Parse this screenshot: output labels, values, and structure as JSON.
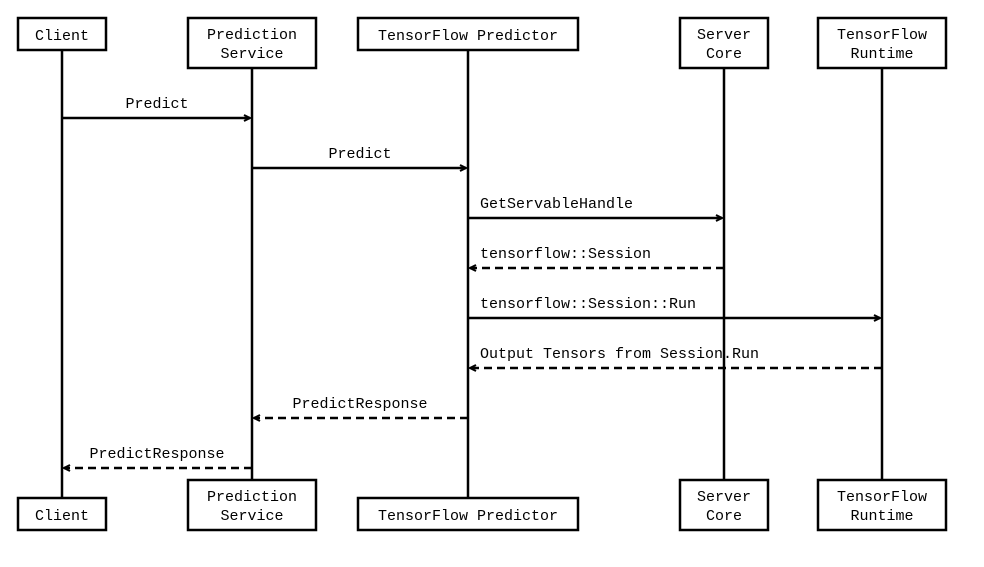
{
  "diagram": {
    "type": "sequence",
    "participants": [
      {
        "id": "client",
        "label_lines": [
          "Client"
        ]
      },
      {
        "id": "prediction_service",
        "label_lines": [
          "Prediction",
          "Service"
        ]
      },
      {
        "id": "tf_predictor",
        "label_lines": [
          "TensorFlow Predictor"
        ]
      },
      {
        "id": "server_core",
        "label_lines": [
          "Server",
          "Core"
        ]
      },
      {
        "id": "tf_runtime",
        "label_lines": [
          "TensorFlow",
          "Runtime"
        ]
      }
    ],
    "messages": [
      {
        "from": "client",
        "to": "prediction_service",
        "text": "Predict",
        "style": "solid"
      },
      {
        "from": "prediction_service",
        "to": "tf_predictor",
        "text": "Predict",
        "style": "solid"
      },
      {
        "from": "tf_predictor",
        "to": "server_core",
        "text": "GetServableHandle",
        "style": "solid"
      },
      {
        "from": "server_core",
        "to": "tf_predictor",
        "text": "tensorflow::Session",
        "style": "dashed"
      },
      {
        "from": "tf_predictor",
        "to": "tf_runtime",
        "text": "tensorflow::Session::Run",
        "style": "solid"
      },
      {
        "from": "tf_runtime",
        "to": "tf_predictor",
        "text": "Output Tensors from Session.Run",
        "style": "dashed"
      },
      {
        "from": "tf_predictor",
        "to": "prediction_service",
        "text": "PredictResponse",
        "style": "dashed"
      },
      {
        "from": "prediction_service",
        "to": "client",
        "text": "PredictResponse",
        "style": "dashed"
      }
    ]
  }
}
